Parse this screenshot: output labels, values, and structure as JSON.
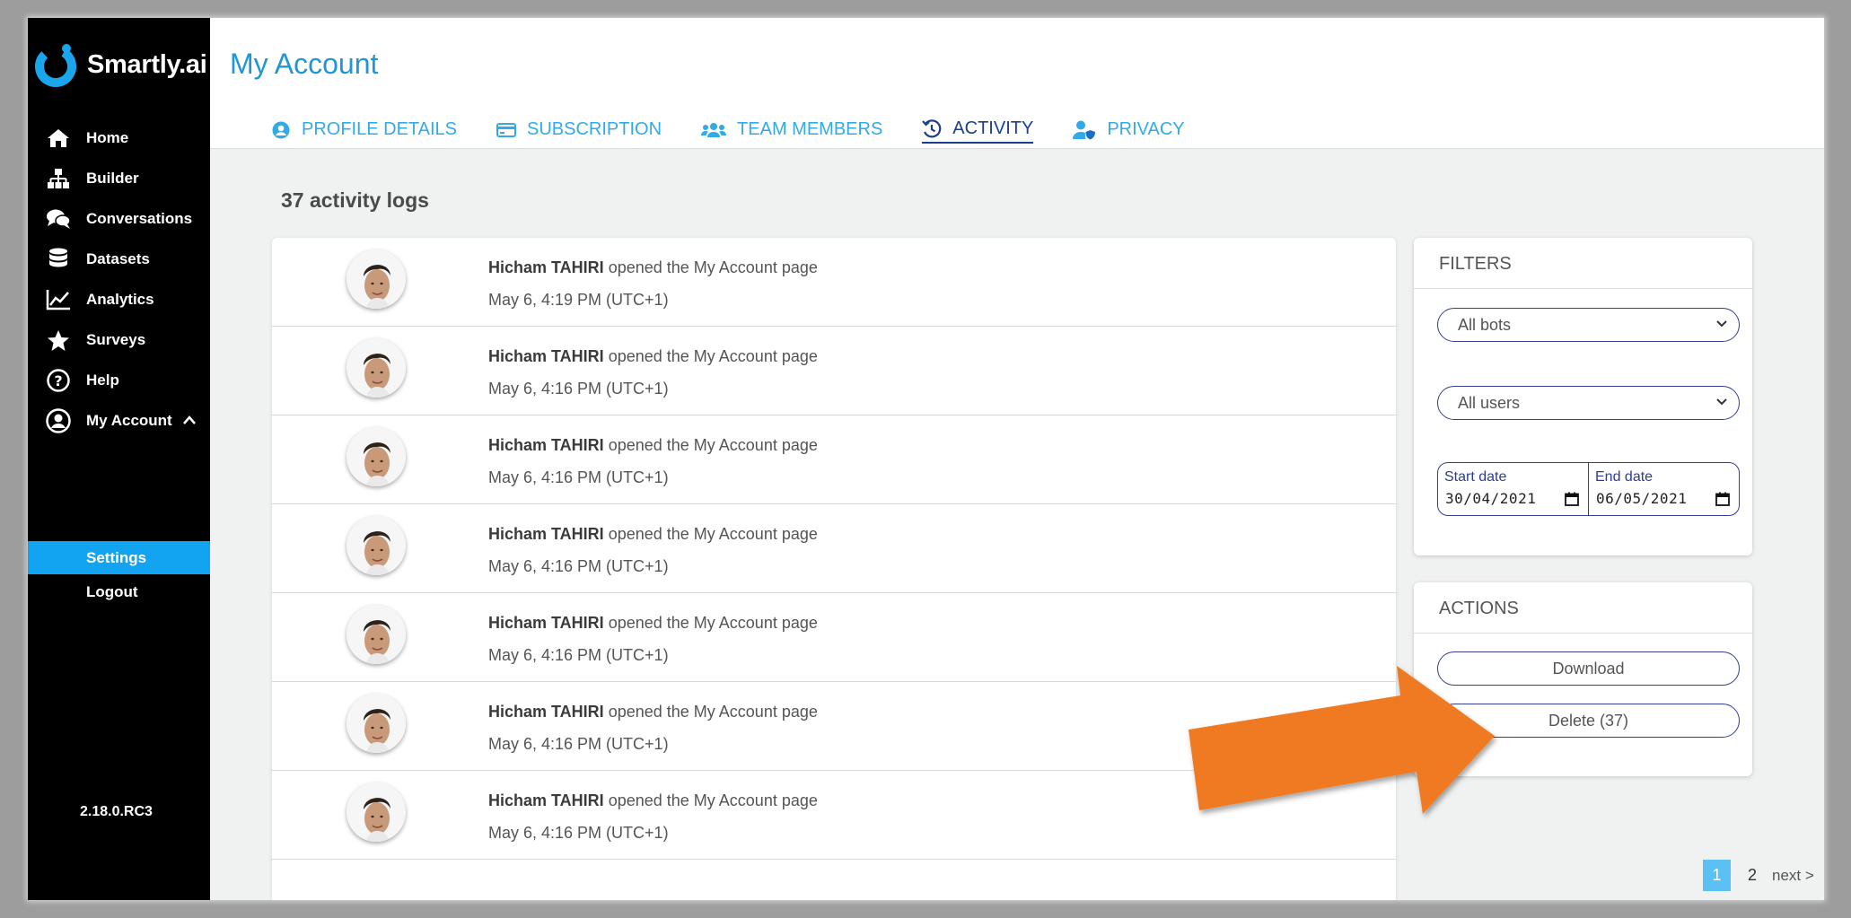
{
  "app": {
    "name": "Smartly.ai",
    "version": "2.18.0.RC3"
  },
  "sidebar": {
    "items": [
      {
        "label": "Home",
        "icon": "home-icon"
      },
      {
        "label": "Builder",
        "icon": "sitemap-icon"
      },
      {
        "label": "Conversations",
        "icon": "comments-icon"
      },
      {
        "label": "Datasets",
        "icon": "database-icon"
      },
      {
        "label": "Analytics",
        "icon": "chart-line-icon"
      },
      {
        "label": "Surveys",
        "icon": "star-icon"
      },
      {
        "label": "Help",
        "icon": "question-circle-icon"
      },
      {
        "label": "My Account",
        "icon": "user-circle-icon"
      }
    ],
    "sub_items": [
      {
        "label": "Settings",
        "active": true
      },
      {
        "label": "Logout",
        "active": false
      }
    ]
  },
  "header": {
    "title": "My Account",
    "tabs": [
      {
        "label": "PROFILE DETAILS",
        "icon": "user-circle-icon",
        "active": false
      },
      {
        "label": "SUBSCRIPTION",
        "icon": "credit-card-icon",
        "active": false
      },
      {
        "label": "TEAM MEMBERS",
        "icon": "users-icon",
        "active": false
      },
      {
        "label": "ACTIVITY",
        "icon": "history-icon",
        "active": true
      },
      {
        "label": "PRIVACY",
        "icon": "user-shield-icon",
        "active": false
      }
    ]
  },
  "activity": {
    "count_label": "37 activity logs",
    "logs": [
      {
        "user": "Hicham TAHIRI",
        "action": "opened the My Account page",
        "time": "May 6, 4:19 PM (UTC+1)"
      },
      {
        "user": "Hicham TAHIRI",
        "action": "opened the My Account page",
        "time": "May 6, 4:16 PM (UTC+1)"
      },
      {
        "user": "Hicham TAHIRI",
        "action": "opened the My Account page",
        "time": "May 6, 4:16 PM (UTC+1)"
      },
      {
        "user": "Hicham TAHIRI",
        "action": "opened the My Account page",
        "time": "May 6, 4:16 PM (UTC+1)"
      },
      {
        "user": "Hicham TAHIRI",
        "action": "opened the My Account page",
        "time": "May 6, 4:16 PM (UTC+1)"
      },
      {
        "user": "Hicham TAHIRI",
        "action": "opened the My Account page",
        "time": "May 6, 4:16 PM (UTC+1)"
      },
      {
        "user": "Hicham TAHIRI",
        "action": "opened the My Account page",
        "time": "May 6, 4:16 PM (UTC+1)"
      }
    ]
  },
  "filters": {
    "title": "FILTERS",
    "bots_select": "All bots",
    "users_select": "All users",
    "start_label": "Start date",
    "start_value": "30/04/2021",
    "end_label": "End date",
    "end_value": "06/05/2021"
  },
  "actions": {
    "title": "ACTIONS",
    "download_label": "Download",
    "delete_label": "Delete (37)"
  },
  "pagination": {
    "current": "1",
    "next_page": "2",
    "next_label": "next >"
  },
  "colors": {
    "accent": "#12a4f0",
    "title_blue": "#1f97d6",
    "tab_active": "#1b3f8d",
    "border_navy": "#343e92",
    "annotation_arrow": "#f07a23"
  }
}
